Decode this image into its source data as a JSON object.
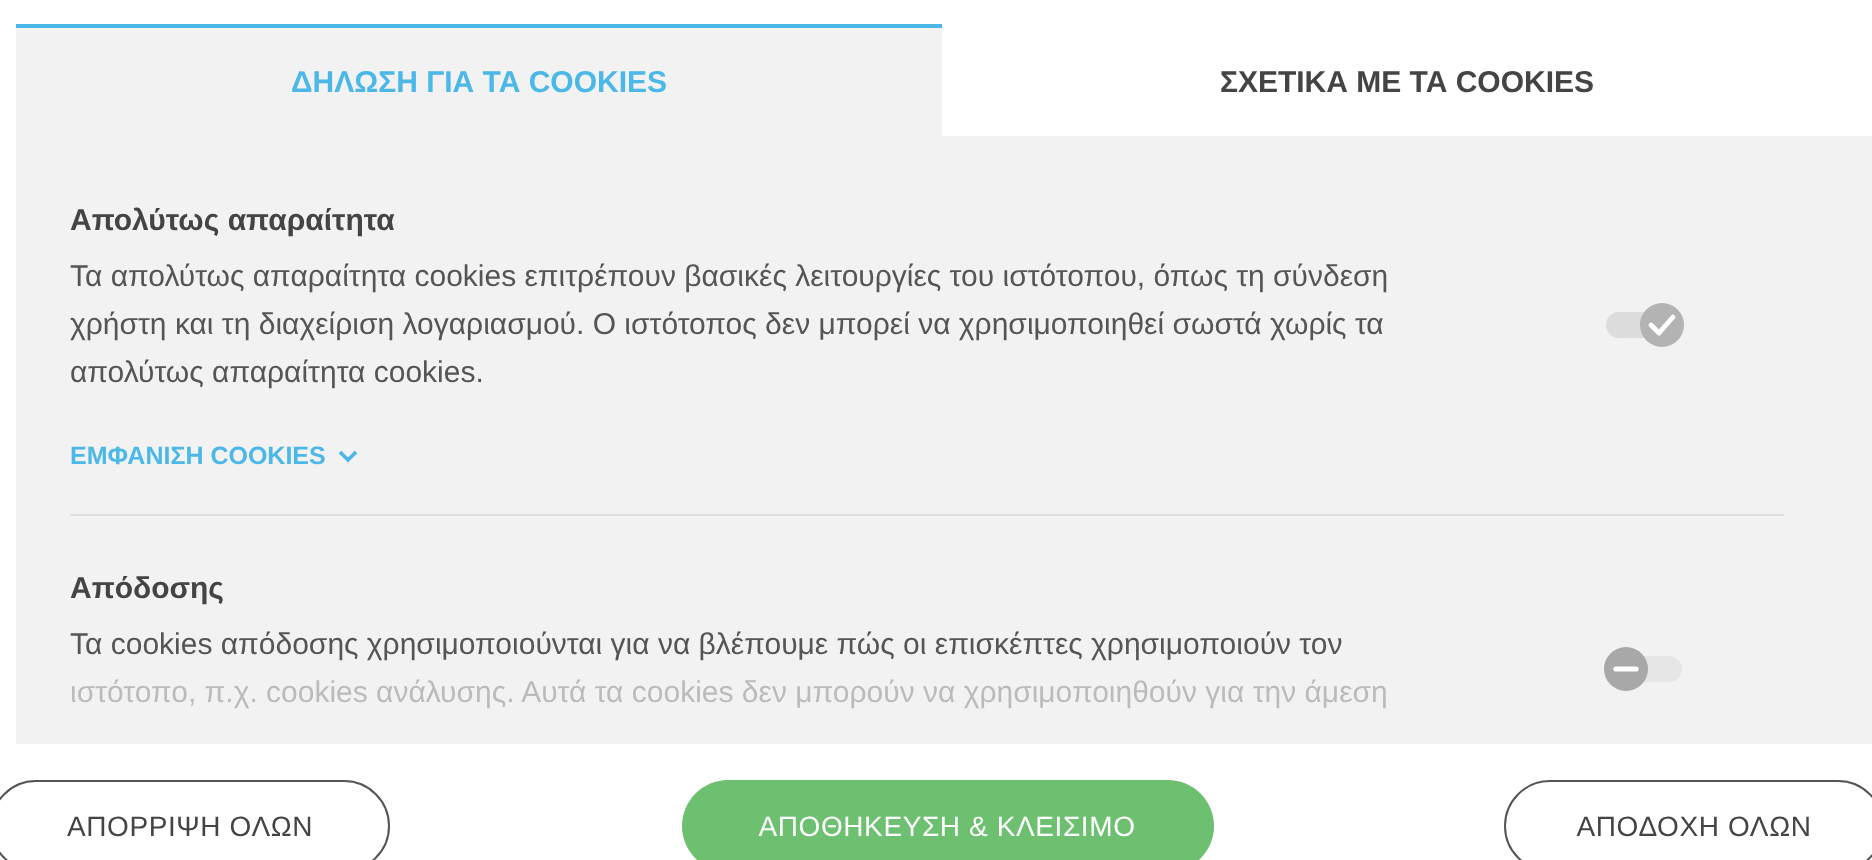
{
  "tabs": [
    {
      "label": "ΔΗΛΩΣΗ ΓΙΑ ΤΑ COOKIES",
      "selected": true
    },
    {
      "label": "ΣΧΕΤΙΚΑ ΜΕ ΤΑ COOKIES",
      "selected": false
    }
  ],
  "sections": [
    {
      "title": "Απολύτως απαραίτητα",
      "description": "Τα απολύτως απαραίτητα cookies επιτρέπουν βασικές λειτουργίες του ιστότοπου, όπως τη σύνδεση χρήστη και τη διαχείριση λογαριασμού. Ο ιστότοπος δεν μπορεί να χρησιμοποιηθεί σωστά χωρίς τα απολύτως απαραίτητα cookies.",
      "on": true,
      "disabled": true,
      "link": "ΕΜΦΑΝΙΣΗ COOKIES"
    },
    {
      "title": "Απόδοσης",
      "description": "Τα cookies απόδοσης χρησιμοποιούνται για να βλέπουμε πώς οι επισκέπτες χρησιμοποιούν τον ιστότοπο, π.χ. cookies ανάλυσης. Αυτά τα cookies δεν μπορούν να χρησιμοποιηθούν για την άμεση",
      "on": false,
      "disabled": false
    }
  ],
  "buttons": [
    {
      "label": "ΑΠΟΡΡΙΨΗ ΟΛΩΝ",
      "kind": "outline"
    },
    {
      "label": "ΑΠΟΘΗΚΕΥΣΗ & ΚΛΕΙΣΙΜΟ",
      "kind": "primary"
    },
    {
      "label": "ΑΠΟΔΟΧΗ ΟΛΩΝ",
      "kind": "outline"
    }
  ]
}
